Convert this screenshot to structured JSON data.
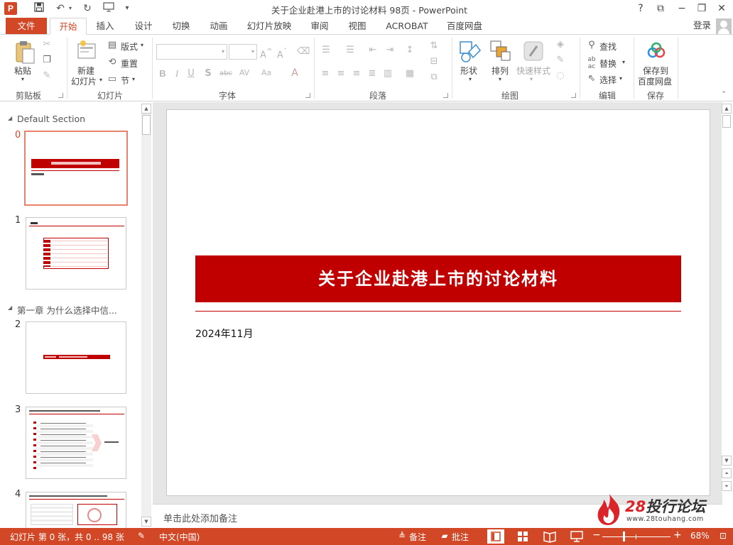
{
  "titlebar": {
    "app_icon": "P",
    "title": "关于企业赴港上市的讨论材料 98页 - PowerPoint",
    "qat_icons": [
      "save-icon",
      "undo-icon",
      "redo-icon",
      "start-slideshow-icon",
      "customize-qat-icon"
    ],
    "win_buttons": [
      "?",
      "⧉",
      "−",
      "❐",
      "✕"
    ]
  },
  "tabs": {
    "file": "文件",
    "items": [
      "开始",
      "插入",
      "设计",
      "切换",
      "动画",
      "幻灯片放映",
      "审阅",
      "视图",
      "ACROBAT",
      "百度网盘"
    ],
    "active": "开始",
    "login": "登录"
  },
  "ribbon": {
    "clipboard": {
      "paste": "粘贴",
      "label": "剪贴板"
    },
    "slides": {
      "new_slide_line1": "新建",
      "new_slide_line2": "幻灯片",
      "layout": "版式",
      "reset": "重置",
      "section": "节",
      "label": "幻灯片"
    },
    "font": {
      "label": "字体",
      "font_name": "",
      "font_size": ""
    },
    "paragraph": {
      "label": "段落"
    },
    "drawing": {
      "shapes": "形状",
      "arrange": "排列",
      "quick_styles": "快速样式",
      "label": "绘图"
    },
    "editing": {
      "find": "查找",
      "replace": "替换",
      "select": "选择",
      "label": "编辑"
    },
    "save": {
      "line1": "保存到",
      "line2": "百度网盘",
      "label": "保存"
    }
  },
  "panel": {
    "sections": [
      "Default Section",
      "第一章 为什么选择中信..."
    ],
    "slide_numbers": [
      "0",
      "1",
      "2",
      "3",
      "4"
    ],
    "selected_slide": "0"
  },
  "slide": {
    "title": "关于企业赴港上市的讨论材料",
    "date": "2024年11月",
    "accent_color": "#c00000"
  },
  "notes": {
    "placeholder": "单击此处添加备注"
  },
  "watermark": {
    "number": "28",
    "name": "投行论坛",
    "url": "www.28touhang.com"
  },
  "status": {
    "slide_info": "幻灯片 第 0 张，共 0 .. 98 张",
    "language": "中文(中国)",
    "notes": "备注",
    "comments": "批注",
    "zoom": "68%",
    "zoom_level": 0.68,
    "bar_color": "#d24726"
  }
}
